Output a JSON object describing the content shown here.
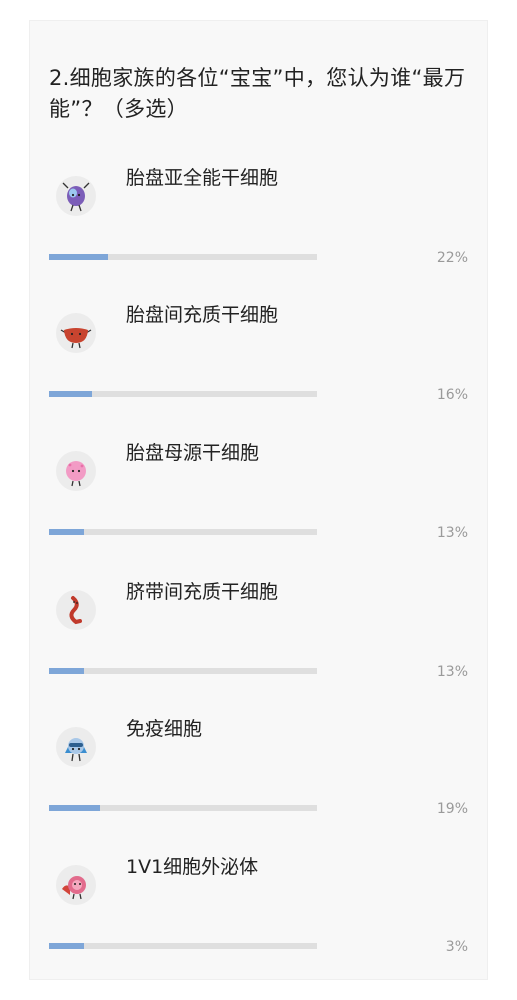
{
  "survey": {
    "question": "2.细胞家族的各位“宝宝”中，您认为谁“最万能”？（多选）",
    "options": [
      {
        "label": "胎盘亚全能干细胞",
        "percent_text": "22%",
        "percent": 22,
        "bar_fill_fraction": 0.22,
        "icon": "blue-cell-mascot-icon"
      },
      {
        "label": "胎盘间充质干细胞",
        "percent_text": "16%",
        "percent": 16,
        "bar_fill_fraction": 0.16,
        "icon": "red-placenta-mascot-icon"
      },
      {
        "label": "胎盘母源干细胞",
        "percent_text": "13%",
        "percent": 13,
        "bar_fill_fraction": 0.13,
        "icon": "pink-cell-mascot-icon"
      },
      {
        "label": "脐带间充质干细胞",
        "percent_text": "13%",
        "percent": 13,
        "bar_fill_fraction": 0.13,
        "icon": "umbilical-cord-mascot-icon"
      },
      {
        "label": "免疫细胞",
        "percent_text": "19%",
        "percent": 19,
        "bar_fill_fraction": 0.19,
        "icon": "immune-cell-mascot-icon"
      },
      {
        "label": "1V1细胞外泌体",
        "percent_text": "3%",
        "percent": 3,
        "bar_fill_fraction": 0.13,
        "icon": "exosome-mascot-icon"
      }
    ]
  },
  "colors": {
    "bar_fill": "#7ea6d8",
    "bar_track": "#dfdfdf",
    "card_background": "#f8f8f8",
    "percent_text": "#9a9a9a"
  }
}
